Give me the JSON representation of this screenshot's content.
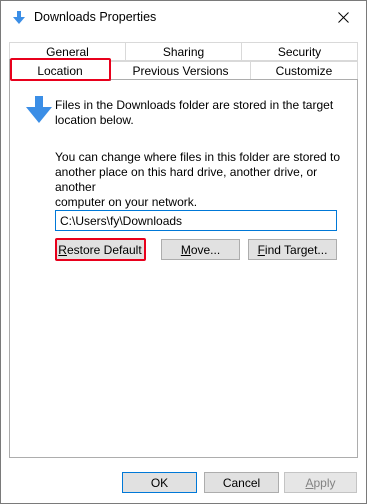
{
  "window": {
    "title": "Downloads Properties",
    "title_icon": "download-arrow-icon",
    "close_icon": "close-icon"
  },
  "tabs": {
    "row1": [
      {
        "label": "General"
      },
      {
        "label": "Sharing"
      },
      {
        "label": "Security"
      }
    ],
    "row2": [
      {
        "label": "Location",
        "active": true,
        "highlighted": true
      },
      {
        "label": "Previous Versions"
      },
      {
        "label": "Customize"
      }
    ]
  },
  "location": {
    "icon": "download-arrow-icon",
    "info_text": "Files in the Downloads folder are stored in the target\nlocation below.",
    "change_text": "You can change where files in this folder are stored to\nanother place on this hard drive, another drive, or another\ncomputer on your network.",
    "path_value": "C:\\Users\\fy\\Downloads",
    "buttons": {
      "restore_default_pre": "",
      "restore_default_access": "R",
      "restore_default_post": "estore Default",
      "move_pre": "",
      "move_access": "M",
      "move_post": "ove...",
      "find_target_pre": "",
      "find_target_access": "F",
      "find_target_post": "ind Target..."
    }
  },
  "footer": {
    "ok_label": "OK",
    "cancel_label": "Cancel",
    "apply_pre": "",
    "apply_access": "A",
    "apply_post": "pply",
    "apply_disabled": true
  },
  "colors": {
    "accent": "#0078d7",
    "highlight": "#e8001c",
    "arrow_blue": "#3b8ee6"
  }
}
